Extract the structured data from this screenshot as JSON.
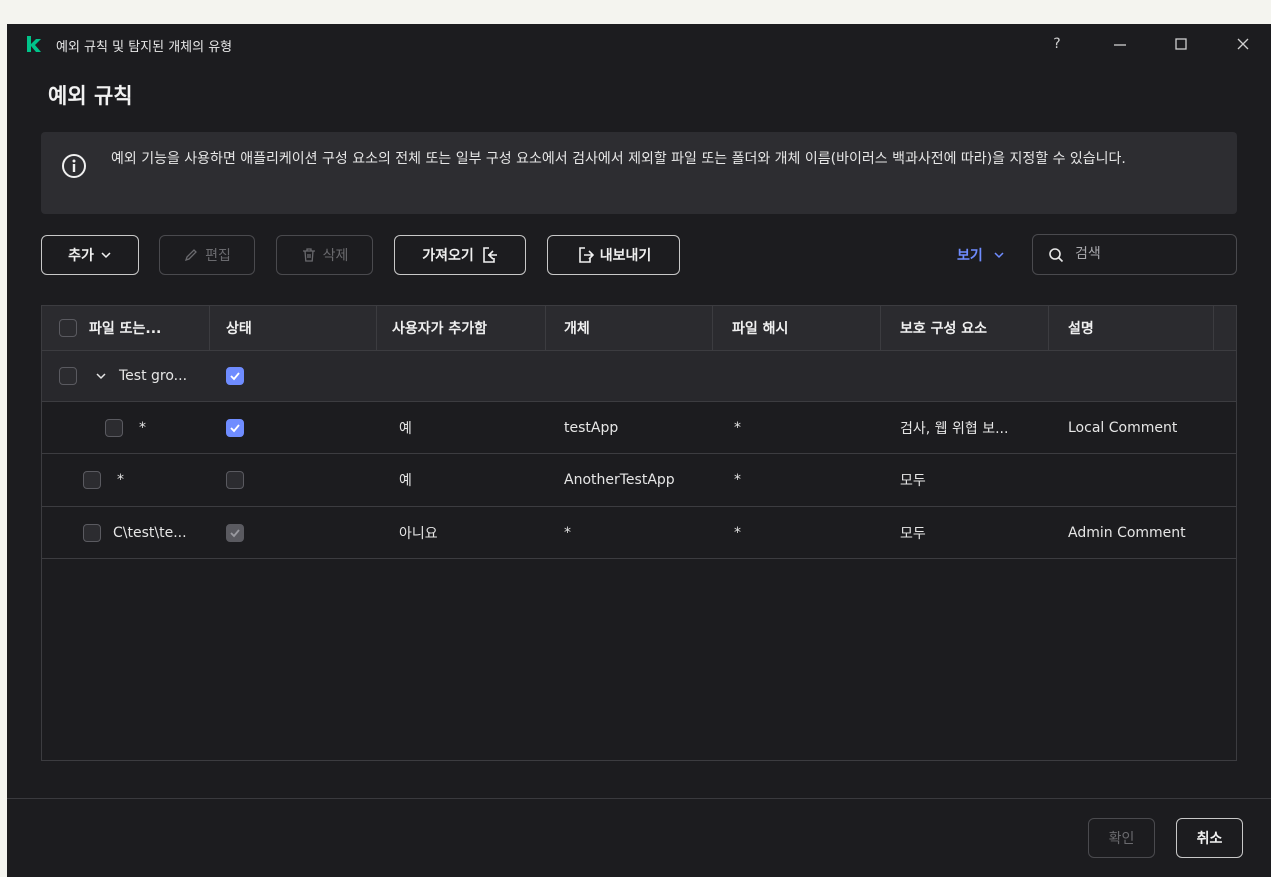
{
  "window": {
    "title": "예외 규칙 및 탐지된 개체의 유형",
    "help_label": "?"
  },
  "page": {
    "title": "예외 규칙"
  },
  "info": {
    "text": "예외 기능을 사용하면 애플리케이션 구성 요소의 전체 또는 일부 구성 요소에서 검사에서 제외할 파일 또는 폴더와 개체 이름(바이러스 백과사전에 따라)을 지정할 수 있습니다."
  },
  "toolbar": {
    "add_label": "추가",
    "edit_label": "편집",
    "delete_label": "삭제",
    "import_label": "가져오기",
    "export_label": "내보내기",
    "view_label": "보기"
  },
  "search": {
    "placeholder": "검색"
  },
  "table": {
    "headers": [
      "파일 또는...",
      "상태",
      "사용자가 추가함",
      "개체",
      "파일 해시",
      "보호 구성 요소",
      "설명"
    ],
    "group": {
      "name": "Test gro...",
      "status_checked": true
    },
    "rows": [
      {
        "file": "*",
        "added_by_user": "예",
        "object": "testApp",
        "hash": "*",
        "components": "검사, 웹 위협 보...",
        "description": "Local Comment"
      },
      {
        "file": "*",
        "added_by_user": "예",
        "object": "AnotherTestApp",
        "hash": "*",
        "components": "모두",
        "description": ""
      },
      {
        "file": "C\\test\\te...",
        "added_by_user": "아니요",
        "object": "*",
        "hash": "*",
        "components": "모두",
        "description": "Admin Comment"
      }
    ]
  },
  "footer": {
    "ok_label": "확인",
    "cancel_label": "취소"
  },
  "colors": {
    "background": "#1c1c1f",
    "panel": "#2d2d31",
    "accent": "#6f8cff",
    "brand": "#00c389"
  }
}
